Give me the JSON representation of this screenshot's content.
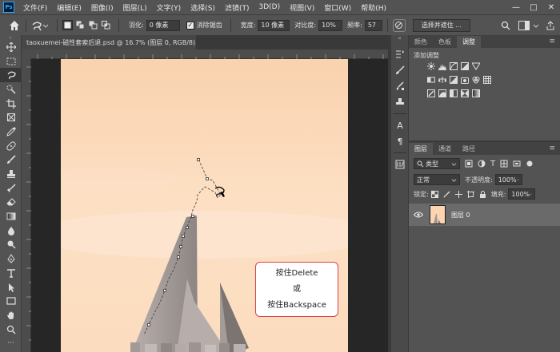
{
  "app": {
    "logo": "Ps"
  },
  "menu": {
    "items": [
      "文件(F)",
      "编辑(E)",
      "图像(I)",
      "图层(L)",
      "文字(Y)",
      "选择(S)",
      "滤镜(T)",
      "3D(D)",
      "视图(V)",
      "窗口(W)",
      "帮助(H)"
    ]
  },
  "window_controls": {
    "minimize": "—",
    "restore": "□",
    "close": "✕"
  },
  "options": {
    "feather_label": "羽化:",
    "feather_value": "0 像素",
    "antialias_label": "消除锯齿",
    "antialias_checked": true,
    "width_label": "宽度:",
    "width_value": "10 像素",
    "contrast_label": "对比度:",
    "contrast_value": "10%",
    "frequency_label": "频率:",
    "frequency_value": "57",
    "select_mask_button": "选择并遮住 ..."
  },
  "document": {
    "tab_title": "taoxuemei-磁性套索后退.psd @ 16.7% (图层 0, RGB/8) *",
    "tab_close": "×"
  },
  "callout": {
    "line1": "按住Delete",
    "line2": "或",
    "line3": "按住Backspace"
  },
  "panels": {
    "top_tabs": [
      "颜色",
      "色板",
      "调整"
    ],
    "adjustments_title": "添加调整",
    "layers_tabs": [
      "图层",
      "通道",
      "路径"
    ],
    "filter_label": "类型",
    "blend_mode": "正常",
    "opacity_label": "不透明度:",
    "opacity_value": "100%",
    "lock_label": "锁定:",
    "fill_label": "填充:",
    "fill_value": "100%",
    "layer_name": "图层 0"
  },
  "colors": {
    "accent_red": "#d9434a",
    "ui_bg": "#535353",
    "canvas_sky": "#fcd4b0"
  }
}
